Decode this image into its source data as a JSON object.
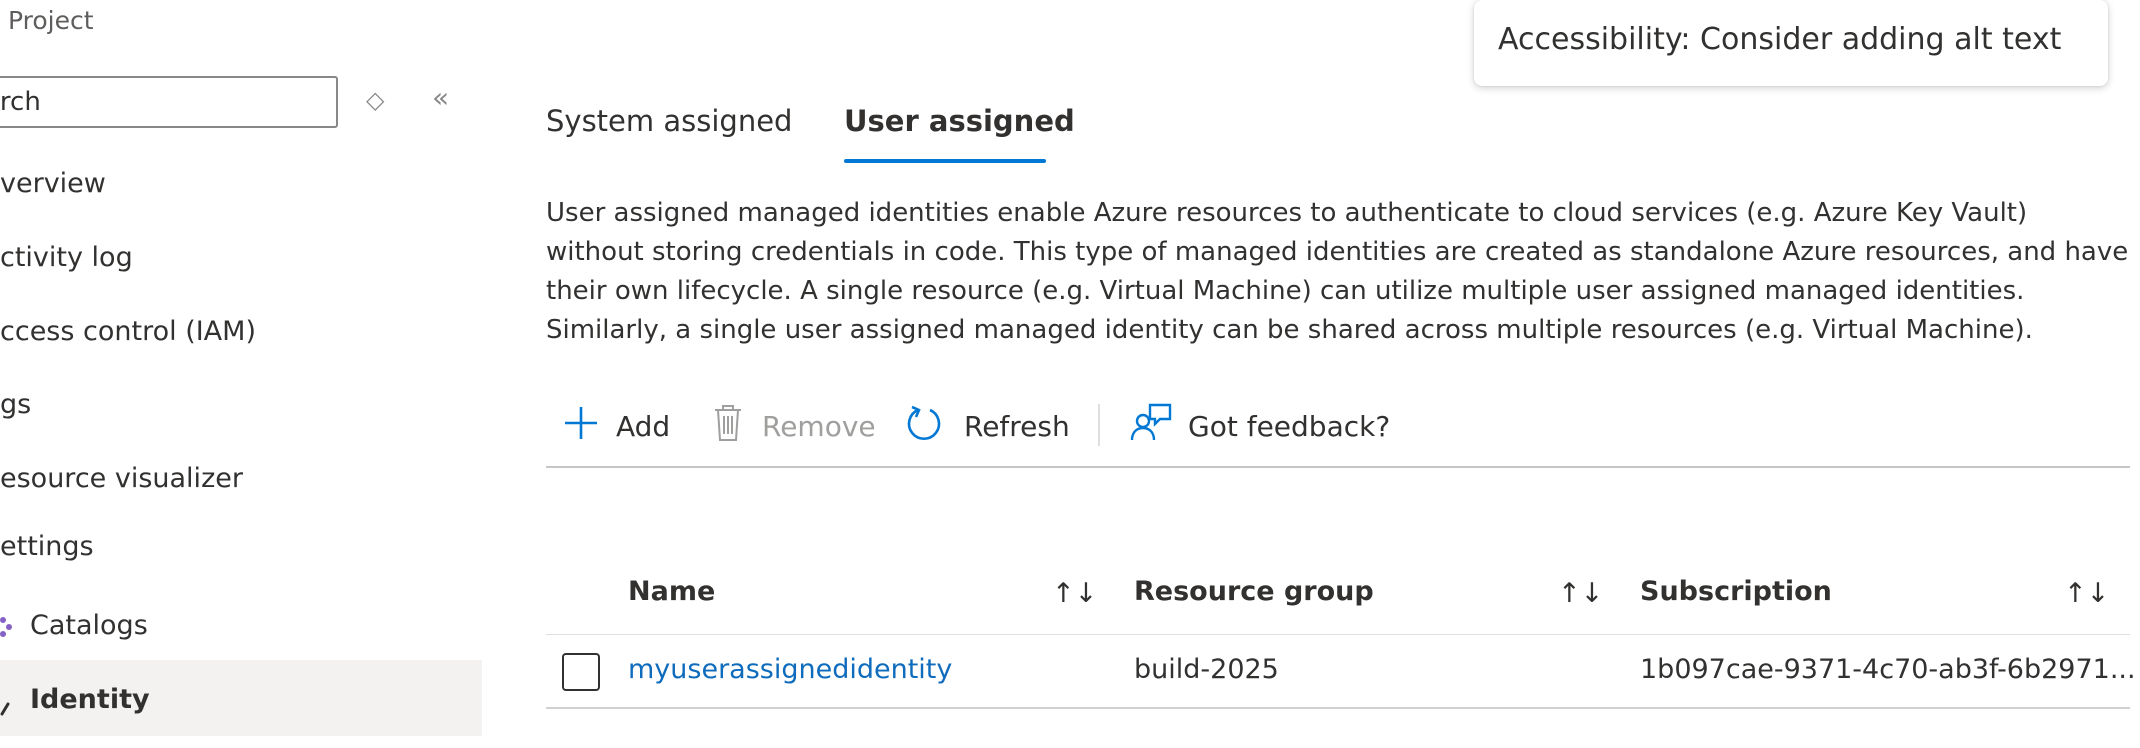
{
  "sidebar": {
    "project_label": "Project",
    "search_placeholder": "arch",
    "nav_items": [
      {
        "label": "verview"
      },
      {
        "label": "ctivity log"
      },
      {
        "label": "ccess control (IAM)"
      },
      {
        "label": "gs"
      },
      {
        "label": "esource visualizer"
      },
      {
        "label": "ettings"
      },
      {
        "label": "Catalogs"
      },
      {
        "label": "Identity"
      }
    ]
  },
  "tabs": [
    {
      "label": "System assigned"
    },
    {
      "label": "User assigned",
      "active": true
    }
  ],
  "description": [
    "User assigned managed identities enable Azure resources to authenticate to cloud services (e.g. Azure Key Vault)",
    "without storing credentials in code. This type of managed identities are created as standalone Azure resources, and have",
    "their own lifecycle. A single resource (e.g. Virtual Machine) can utilize multiple user assigned managed identities.",
    "Similarly, a single user assigned managed identity can be shared across multiple resources (e.g. Virtual Machine)."
  ],
  "toolbar": {
    "add_label": "Add",
    "remove_label": "Remove",
    "refresh_label": "Refresh",
    "feedback_label": "Got feedback?"
  },
  "table": {
    "columns": [
      "Name",
      "Resource group",
      "Subscription"
    ],
    "sort_glyph": "↑↓",
    "rows": [
      {
        "name": "myuserassignedidentity",
        "resource_group": "build-2025",
        "subscription": "1b097cae-9371-4c70-ab3f-6b2971..."
      }
    ]
  },
  "tooltip": {
    "text": "Accessibility: Consider adding alt text"
  },
  "colors": {
    "accent": "#0078d4",
    "link": "#0f6cbd",
    "disabled": "#a19f9d"
  }
}
